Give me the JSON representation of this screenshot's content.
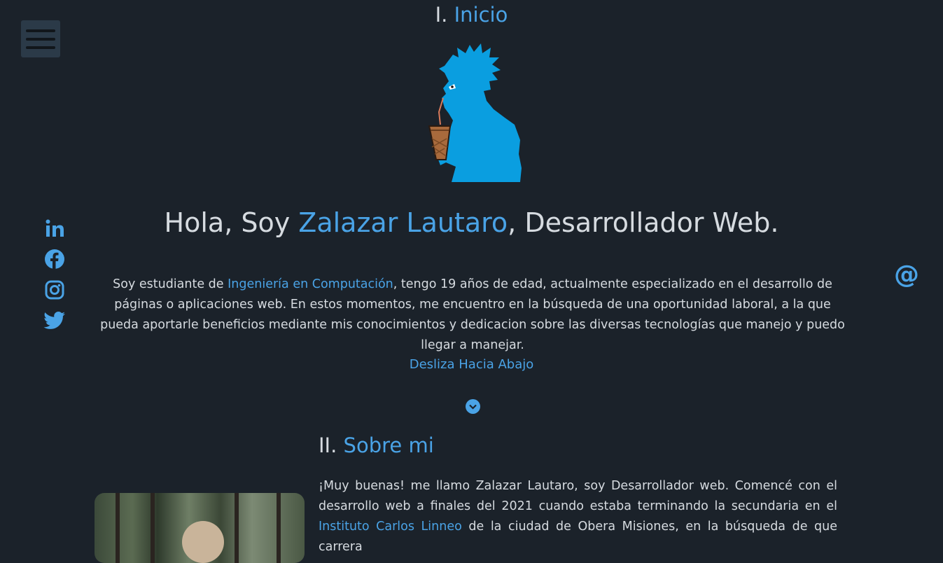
{
  "nav": {
    "menu_icon": "hamburger-icon"
  },
  "social_icons": [
    "linkedin-icon",
    "facebook-icon",
    "instagram-icon",
    "twitter-icon"
  ],
  "contact_icon": {
    "name": "at-icon",
    "glyph": "@"
  },
  "section1": {
    "number": "I.",
    "title": "Inicio",
    "hero_prefix": "Hola, Soy ",
    "hero_name": "Zalazar Lautaro",
    "hero_suffix": ", Desarrollador Web.",
    "intro_before": "Soy estudiante de ",
    "intro_link": "Ingeniería en Computación",
    "intro_after": ", tengo 19 años de edad, actualmente especializado en el desarrollo de páginas o aplicaciones web. En estos momentos, me encuentro en la búsqueda de una oportunidad laboral, a la que pueda aportarle beneficios mediante mis conocimientos y dedicacion sobre las diversas tecnologías que manejo y puedo llegar a manejar.",
    "scroll_label": "Desliza Hacia Abajo"
  },
  "section2": {
    "number": "II.",
    "title": "Sobre mi",
    "about_before": "¡Muy buenas! me llamo Zalazar Lautaro, soy Desarrollador web. Comencé con el desarrollo web a finales del 2021 cuando estaba terminando la secundaria en el ",
    "about_link": "Instituto Carlos Linneo",
    "about_after": " de la ciudad de Obera Misiones, en la búsqueda de que carrera"
  },
  "colors": {
    "background": "#1b222a",
    "accent": "#4aa3e6",
    "text": "#d6dbe0",
    "avatar": "#0a9ee0"
  }
}
